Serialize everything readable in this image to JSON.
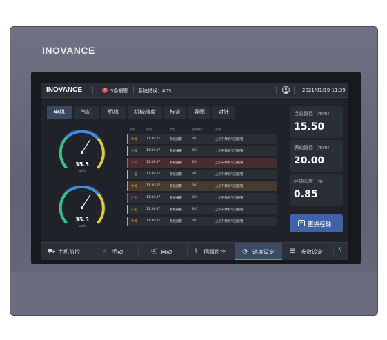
{
  "device": {
    "logo": "INOVANCE"
  },
  "topbar": {
    "brand": "INOVANCE",
    "alarm_icon": "!",
    "alarm_text": "3条报警",
    "system_error": "系统错误：403",
    "datetime": "2021/01/19  11:39"
  },
  "tabs": [
    "电机",
    "气缸",
    "相机",
    "机械精度",
    "标定",
    "导图",
    "对针"
  ],
  "active_tab": 0,
  "gauges": [
    {
      "value": "35.5",
      "unit": "km/h",
      "level": 0.62
    },
    {
      "value": "35.5",
      "unit": "km/h",
      "level": 0.62
    }
  ],
  "table": {
    "headers": [
      "报警",
      "时间",
      "类型",
      "报警编号",
      "说明"
    ],
    "rows": [
      {
        "level": "中等",
        "time": "11:39:47",
        "type": "系统报警",
        "code": "201",
        "desc": "上机升降机气缸报警",
        "color": "#e89a2b",
        "bg": "#2a2e37"
      },
      {
        "level": "一般",
        "time": "11:39:47",
        "type": "系统报警",
        "code": "201",
        "desc": "上机升降机气缸报警",
        "color": "#d8c43a",
        "bg": "#2a2e37"
      },
      {
        "level": "严重",
        "time": "11:39:47",
        "type": "系统报警",
        "code": "201",
        "desc": "上机升降机气缸报警",
        "color": "#e04848",
        "bg": "#4a2b30"
      },
      {
        "level": "一般",
        "time": "11:39:47",
        "type": "系统报警",
        "code": "201",
        "desc": "上机升降机气缸报警",
        "color": "#d8c43a",
        "bg": "#2a2e37"
      },
      {
        "level": "中等",
        "time": "11:39:47",
        "type": "系统报警",
        "code": "201",
        "desc": "上机升降机气缸报警",
        "color": "#e89a2b",
        "bg": "#463a31"
      },
      {
        "level": "严重",
        "time": "11:39:47",
        "type": "系统报警",
        "code": "201",
        "desc": "上机升降机气缸报警",
        "color": "#e04848",
        "bg": "#2a2e37"
      },
      {
        "level": "一般",
        "time": "11:39:47",
        "type": "系统报警",
        "code": "201",
        "desc": "上机升降机气缸报警",
        "color": "#d8c43a",
        "bg": "#2a2e37"
      },
      {
        "level": "中等",
        "time": "11:39:47",
        "type": "系统报警",
        "code": "201",
        "desc": "上机升降机气缸报警",
        "color": "#e89a2b",
        "bg": "#2a2e37"
      }
    ]
  },
  "panels": [
    {
      "label": "当前直径（mm）",
      "value": "15.50"
    },
    {
      "label": "满轴直径（mm）",
      "value": "20.00"
    },
    {
      "label": "经轴长度（m）",
      "value": "0.85"
    }
  ],
  "change_button": {
    "label": "更换经轴",
    "icon": "swap-icon"
  },
  "bottom_nav": [
    {
      "label": "主机监控",
      "icon": "host-monitor-icon",
      "glyph": "⛟"
    },
    {
      "label": "手动",
      "icon": "hand-icon",
      "glyph": "☝"
    },
    {
      "label": "自动",
      "icon": "auto-icon",
      "glyph": "Ⓐ"
    },
    {
      "label": "伺服监控",
      "icon": "servo-icon",
      "glyph": "⌇"
    },
    {
      "label": "速度设定",
      "icon": "speed-icon",
      "glyph": "◔"
    },
    {
      "label": "参数设定",
      "icon": "params-icon",
      "glyph": "☰"
    }
  ],
  "active_nav": 4,
  "back_icon": "‹",
  "colors": {
    "accent": "#4e9af0",
    "gauge_green": "#2fc38a",
    "gauge_blue": "#3e8ee8",
    "gauge_yellow": "#e6c63a"
  }
}
